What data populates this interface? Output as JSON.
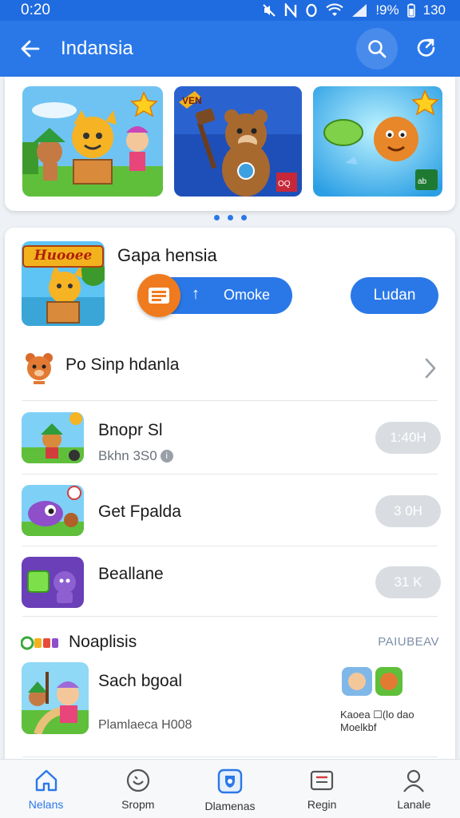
{
  "status_bar": {
    "time": "0:20",
    "battery_text": "!9%",
    "signal_text": "130"
  },
  "app_bar": {
    "title": "Indansia",
    "back_icon": "back-arrow-icon",
    "search_icon": "search-icon",
    "refresh_icon": "refresh-icon"
  },
  "banners": [
    {
      "name": "banner-characters-forest",
      "badge": "star"
    },
    {
      "name": "banner-bear-hammer",
      "badge": "corner-logo"
    },
    {
      "name": "banner-cookie-character",
      "badge": "star"
    }
  ],
  "carousel": {
    "dots": 3,
    "active_index": 0
  },
  "featured": {
    "thumb_text": "Huooee",
    "title": "Gapa hensia",
    "primary_button_label": "Omoke",
    "secondary_button_label": "Ludan"
  },
  "link_row": {
    "label": "Po Sinp hdanla"
  },
  "games": [
    {
      "name": "Bnopr Sl",
      "sub": "Bkhn 3S0",
      "time": "1:40H"
    },
    {
      "name": "Get Fpalda",
      "sub": "",
      "time": "3 0H"
    },
    {
      "name": "Beallane",
      "sub": "",
      "time": "31 K"
    }
  ],
  "section": {
    "logo_text": "O",
    "title": "Noaplisis",
    "link_label": "PAIUBEAV"
  },
  "bottom_game": {
    "name": "Sach bgoal",
    "sub": "Plamlaeca H008",
    "side_caption": "Kaoea ☐(lo dao",
    "side_sub": "Moelkbf"
  },
  "bottom_nav": [
    {
      "label": "Nelans",
      "icon": "home-icon",
      "active": true
    },
    {
      "label": "Sropm",
      "icon": "smile-icon",
      "active": false
    },
    {
      "label": "Dlamenas",
      "icon": "shield-icon",
      "active": false
    },
    {
      "label": "Regin",
      "icon": "inbox-icon",
      "active": false
    },
    {
      "label": "Lanale",
      "icon": "person-icon",
      "active": false
    }
  ],
  "colors": {
    "primary": "#2a78e8",
    "status_bar": "#1f6be0",
    "accent_orange": "#f07b1e",
    "time_pill": "#d9dde1"
  }
}
